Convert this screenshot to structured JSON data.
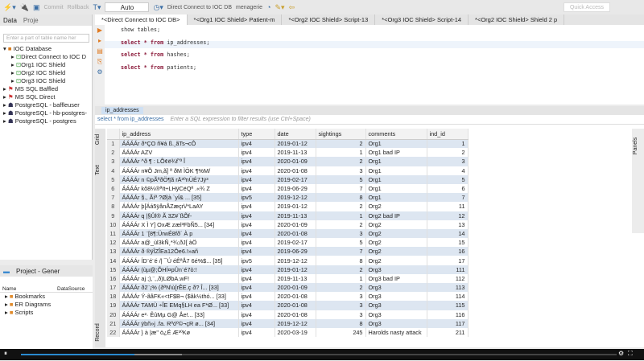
{
  "toolbar": {
    "commit": "Commit",
    "rollback": "Rollback",
    "mode": "Auto",
    "connection": "Direct Connect to IOC DB",
    "schema": "menagerie",
    "quick_access": "Quick Access"
  },
  "left_panel": {
    "tabs": [
      "Data",
      "Proje"
    ],
    "filter_placeholder": "Enter a part of table name her",
    "tree": [
      "IOC Database",
      "Direct Connect to IOC D",
      "Org1 IOC Shield",
      "Org2 IOC Shield",
      "Org3 IOC Shield",
      "MS SQL Baffled",
      "MS SQL Direct",
      "PostgreSQL - baffleuser",
      "PostgreSQL - hb-postgres-",
      "PostgreSQL - postgres"
    ]
  },
  "project_panel": {
    "title": "Project - Gener",
    "columns": [
      "Name",
      "DataSource"
    ],
    "items": [
      "Bookmarks",
      "ER Diagrams",
      "Scripts"
    ]
  },
  "editor": {
    "tabs": [
      "*<Direct Connect to IOC DB>",
      "*<Org1 IOC Shield> Patient-m",
      "*<Org2 IOC Shield> Script-13",
      "*<Org3 IOC Shield> Script-14",
      "*<Org2 IOC Shield> Shield 2 p"
    ],
    "lines": [
      {
        "kw": "",
        "rest": "show tables;"
      },
      {
        "kw": "select * from",
        "rest": " ip_addresses;"
      },
      {
        "kw": "select * from",
        "rest": " hashes;"
      },
      {
        "kw": "select * from",
        "rest": " patients;"
      }
    ]
  },
  "results": {
    "tab": "ip_addresses",
    "query": "select * from ip_addresses",
    "filter_placeholder": "Enter a SQL expression to filter results (use Ctrl+Space)",
    "side_tabs": [
      "Grid",
      "Text",
      "Record"
    ],
    "right_tab": "Panels",
    "columns": [
      "ip_address",
      "type",
      "date",
      "sightings",
      "comments",
      "ind_id"
    ],
    "rows": [
      [
        "ÁÁÁÁr  ð*ÇO ñ¥á ß.¸ãTs¬cÔ",
        "ipv4",
        "2019-01-12",
        "2",
        "Org1",
        "1"
      ],
      [
        "ÁÁÁÁr  AZV",
        "ipv4",
        "2019-11-13",
        "1",
        "Org1 bad IP",
        "2"
      ],
      [
        "ÁÁÁÁr  ^ð ¶ : LÕ¢ë¾f˜ª Î",
        "ipv4",
        "2020-01-09",
        "2",
        "Org1",
        "3"
      ],
      [
        "ÁÁÁÁr  n¥Õ Jm,ã] ª ðM ÌÖK ¶%M/",
        "ipv4",
        "2020-01-08",
        "3",
        "Org1",
        "4"
      ],
      [
        "ÁÁÁÁr  n ©pÃªðÖ¶ã rÄ³ºnÜÉ7Jÿ³",
        "ipv4",
        "2019-02-17",
        "5",
        "Org1",
        "5"
      ],
      [
        "ÁÁÁÁr  kô8¼®ªIt÷LHÿCëQª .«¾ Z",
        "ipv4",
        "2019-06-29",
        "7",
        "Org1",
        "6"
      ],
      [
        "ÁÁÁÁr  §.,  Ãíª ?Ø|à `yÍ& ... [35]",
        "ipv5",
        "2019-12-12",
        "8",
        "Org1",
        "7"
      ],
      [
        "ÁÁÁÁr  þ[Áá5ÿånÅZæçr\\/*LaAY",
        "ipv4",
        "2019-01-12",
        "2",
        "Org2",
        "11"
      ],
      [
        "ÁÁÁÁr  q |§Ûl®  Ã 3Z#`ßÕf-",
        "ipv4",
        "2019-11-13",
        "1",
        "Org2 bad IP",
        "12"
      ],
      [
        "ÁÁÁÁr  X Ì Y]  OxÆ zæl³FbÑ5... [34]",
        "ipv4",
        "2020-01-09",
        "2",
        "Org2",
        "13"
      ],
      [
        "ÁÁÁÁr  1 ¨[8¶:ÜrwÉ8fð´ À p",
        "ipv4",
        "2020-01-08",
        "3",
        "Org2",
        "14"
      ],
      [
        "ÁÁÁÁr  a@_ùl3kÑ¸*¾;ðJ[ àÖ",
        "ipv4",
        "2019-02-17",
        "5",
        "Org2",
        "15"
      ],
      [
        "ÁÁÁÁr  ð ®ÿÎZÎEa12Ôe6.!»añ",
        "ipv4",
        "2019-06-29",
        "7",
        "Org2",
        "16"
      ],
      [
        "ÁÁÁÁr  ÍD¨é¨é /| ¯Ú éÊªÅ7 6é%$... [35]",
        "ipv5",
        "2019-12-12",
        "8",
        "Org2",
        "17"
      ],
      [
        "ÁÁÁÁr  (ùµ@;ÕHÍ¤pÛn¨é7ò:!",
        "ipv4",
        "2019-01-12",
        "2",
        "Org3",
        "111"
      ],
      [
        "ÁÁÁÁr  aj ;),¨,,ð)LØbA.wF!",
        "ipv4",
        "2019-11-13",
        "1",
        "Org3 bad IP",
        "112"
      ],
      [
        "ÁÁÁÁr  ð2¨¡% (ðªN\\ù[rÊE.ç ð? Î... [33]",
        "ipv4",
        "2020-01-09",
        "2",
        "Org3",
        "113"
      ],
      [
        "ÁÁÁÁr  Ý-ãåFK«<tF$B¬ ($âk½thó... [33]",
        "ipv4",
        "2020-01-08",
        "3",
        "Org3",
        "114"
      ],
      [
        "ÁÁÁÁr  TAMÙ ÷ÎE EMq§LH ea  F*Ø... [33]",
        "ipv4",
        "2020-01-08",
        "3",
        "Org3",
        "115"
      ],
      [
        "ÁÁÁÁr  e²·  ÊûMµ G@ Åe!... [33]",
        "ipv4",
        "2020-01-08",
        "3",
        "Org3",
        "116"
      ],
      [
        "ÁÁÁÁr  ÿbñ»j .fa. Rºóº©¬çR ø... [34]",
        "ipv4",
        "2019-12-12",
        "8",
        "Org3",
        "117"
      ],
      [
        "ÁÁÁÁr  } à |æ\" ö¿É Æ³ºKø",
        "ipv4",
        "2020-03-19",
        "245",
        "Harolds nasty attack",
        "211"
      ]
    ]
  },
  "video": {
    "progress_percent": 19,
    "buffered_percent": 27
  },
  "colors": {
    "accent": "#3a6ea5",
    "row_alt": "#dde6f1",
    "keyword": "#8b1a3a"
  }
}
